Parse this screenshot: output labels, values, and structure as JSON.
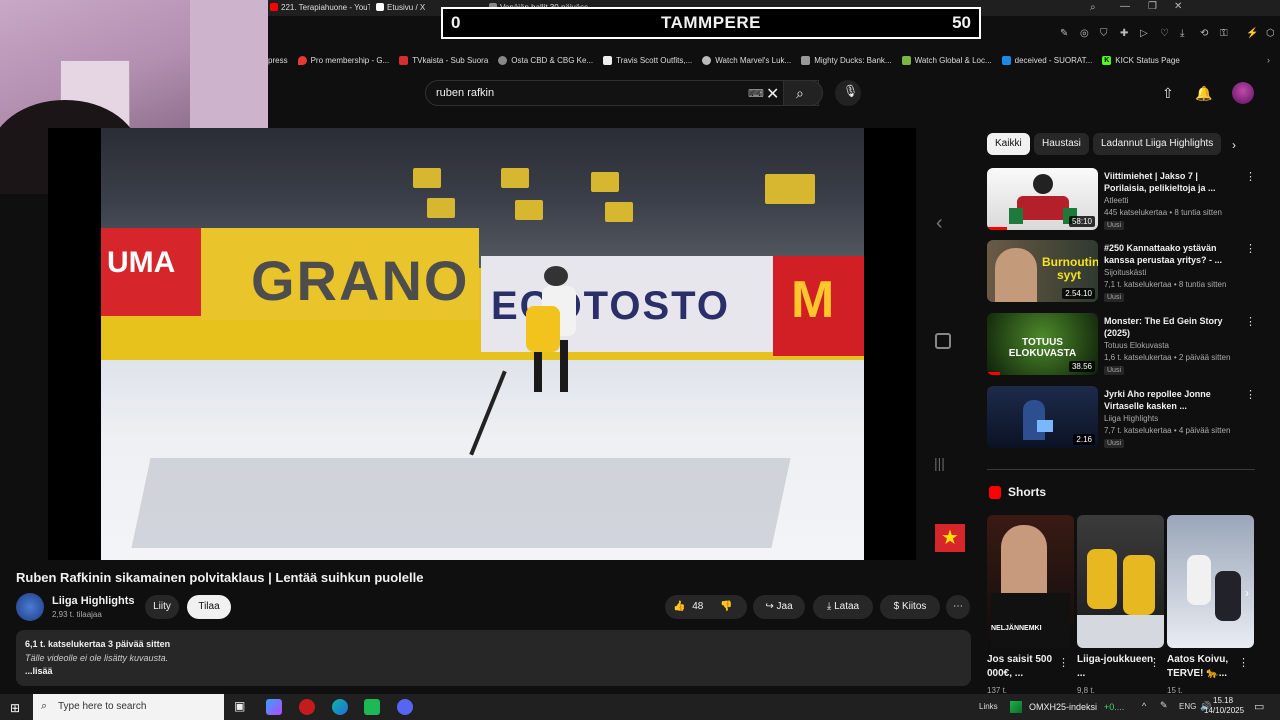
{
  "browser": {
    "tabs": [
      {
        "label": "221. Terapiahuone - YouT",
        "color": "#ff0000"
      },
      {
        "label": "Etusivu / X",
        "color": "#ffffff"
      },
      {
        "label": "Venäjän hallit 30 päiväss.",
        "color": "#888888"
      }
    ],
    "bookmarks": [
      {
        "label": "press",
        "color": "#444444"
      },
      {
        "label": "Pro membership - G...",
        "color": "#e53935"
      },
      {
        "label": "TVkaista - Sub Suora",
        "color": "#d32f2f"
      },
      {
        "label": "Osta CBD & CBG Ke...",
        "color": "#888888"
      },
      {
        "label": "Travis Scott Outfits,...",
        "color": "#eeeeee"
      },
      {
        "label": "Watch Marvel's Luk...",
        "color": "#bbbbbb"
      },
      {
        "label": "Mighty Ducks: Bank...",
        "color": "#999999"
      },
      {
        "label": "Watch Global & Loc...",
        "color": "#7cb342"
      },
      {
        "label": "deceived - SUORAT...",
        "color": "#1e88e5"
      },
      {
        "label": "KICK Status Page",
        "color": "#53fc18"
      }
    ]
  },
  "score": {
    "left": "0",
    "title": "TAMMPERE",
    "right": "50"
  },
  "search": {
    "query": "ruben rafkin"
  },
  "video": {
    "title": "Ruben Rafkinin sikamainen polvitaklaus | Lentää suihkun puolelle",
    "channel": "Liiga Highlights",
    "subscribers": "2,93 t. tilaajaa",
    "join_label": "Liity",
    "subscribe_label": "Tilaa",
    "likes": "48",
    "share_label": "Jaa",
    "download_label": "Lataa",
    "thanks_label": "Kiitos",
    "description_meta": "6,1 t. katselukertaa  3 päivää sitten",
    "description_text": "Tälle videolle ei ole lisätty kuvausta.",
    "more_label": "...lisää"
  },
  "ads": {
    "ad1": "UMA",
    "ad2": "GRANO",
    "ad3": "ECOTOSTO",
    "ad4": "M"
  },
  "chips": [
    "Kaikki",
    "Haustasi",
    "Ladannut Liiga Highlights"
  ],
  "recommendations": [
    {
      "title": "Viittimiehet | Jakso 7 | Porilaisia, pelikieltoja ja ...",
      "channel": "Atleetti",
      "meta": "445 katselukertaa • 8 tuntia sitten",
      "badge": "Uusi",
      "duration": "58:10",
      "progress": 0.18
    },
    {
      "title": "#250 Kannattaako ystävän kanssa perustaa yritys? - ...",
      "channel": "Sijoituskästi",
      "meta": "7,1 t. katselukertaa • 8 tuntia sitten",
      "badge": "Uusi",
      "duration": "2.54.10",
      "overlay": "Burnoutin syyt"
    },
    {
      "title": "Monster: The Ed Gein Story (2025)",
      "channel": "Totuus Elokuvasta",
      "meta": "1,6 t. katselukertaa • 2 päivää sitten",
      "badge": "Uusi",
      "duration": "38.56",
      "overlay": "TOTUUS ELOKUVASTA",
      "progress": 0.12
    },
    {
      "title": "Jyrki Aho repollee Jonne Virtaselle kasken ...",
      "channel": "Liiga Highlights",
      "meta": "7,7 t. katselukertaa • 4 päivää sitten",
      "badge": "Uusi",
      "duration": "2.16"
    }
  ],
  "shorts": {
    "heading": "Shorts",
    "items": [
      {
        "title": "Jos saisit 500 000€, ...",
        "views": "137 t.",
        "overlay": "NELJÄNNEMKI"
      },
      {
        "title": "Liiga-joukkueen ...",
        "views": "9,8 t.",
        "overlay": ""
      },
      {
        "title": "Aatos Koivu, TERVE! 🐆...",
        "views": "15 t.",
        "overlay": ""
      }
    ]
  },
  "taskbar": {
    "search_placeholder": "Type here to search",
    "links": "Links",
    "stock_name": "OMXH25-indeksi",
    "stock_change": "+0....",
    "lang": "ENG",
    "time": "15.18",
    "date": "14/10/2025"
  }
}
